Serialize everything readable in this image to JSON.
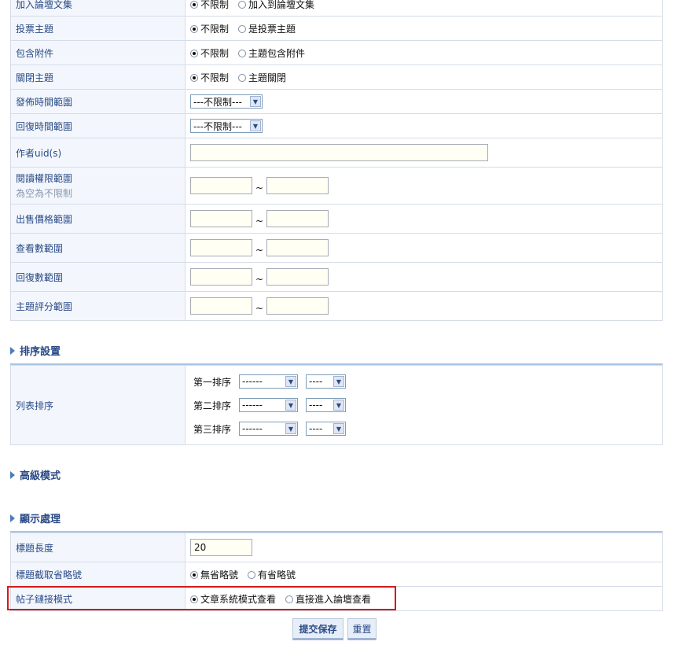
{
  "filter_rows": [
    {
      "label": "加入論壇文集",
      "type": "radio",
      "options": [
        "不限制",
        "加入到論壇文集"
      ],
      "selected": 0
    },
    {
      "label": "投票主題",
      "type": "radio",
      "options": [
        "不限制",
        "是投票主題"
      ],
      "selected": 0
    },
    {
      "label": "包含附件",
      "type": "radio",
      "options": [
        "不限制",
        "主題包含附件"
      ],
      "selected": 0
    },
    {
      "label": "關閉主題",
      "type": "radio",
      "options": [
        "不限制",
        "主題關閉"
      ],
      "selected": 0
    },
    {
      "label": "發佈時間範圍",
      "type": "select",
      "value": "---不限制---"
    },
    {
      "label": "回復時間範圍",
      "type": "select",
      "value": "---不限制---"
    },
    {
      "label": "作者uid(s)",
      "type": "text",
      "value": ""
    },
    {
      "label": "閱讀權限範圍",
      "sublabel": "為空為不限制",
      "type": "range",
      "from": "",
      "to": ""
    },
    {
      "label": "出售價格範圍",
      "type": "range",
      "from": "",
      "to": ""
    },
    {
      "label": "查看數範圍",
      "type": "range",
      "from": "",
      "to": ""
    },
    {
      "label": "回復數範圍",
      "type": "range",
      "from": "",
      "to": ""
    },
    {
      "label": "主題評分範圍",
      "type": "range",
      "from": "",
      "to": ""
    }
  ],
  "range_separator": "~",
  "sections": {
    "sort": "排序設置",
    "advanced": "高級模式",
    "display": "顯示處理"
  },
  "sort": {
    "label": "列表排序",
    "rows": [
      {
        "label": "第一排序",
        "field": "------",
        "order": "----"
      },
      {
        "label": "第二排序",
        "field": "------",
        "order": "----"
      },
      {
        "label": "第三排序",
        "field": "------",
        "order": "----"
      }
    ]
  },
  "display_rows": [
    {
      "label": "標題長度",
      "type": "text",
      "value": "20"
    },
    {
      "label": "標題截取省略號",
      "type": "radio",
      "options": [
        "無省略號",
        "有省略號"
      ],
      "selected": 0
    },
    {
      "label": "帖子鏈接模式",
      "type": "radio",
      "options": [
        "文章系統模式查看",
        "直接進入論壇查看"
      ],
      "selected": 0
    }
  ],
  "buttons": {
    "submit": "提交保存",
    "reset": "重置"
  },
  "colors": {
    "highlight_box": "#d41a1a",
    "section_accent": "#4a7cc0"
  }
}
